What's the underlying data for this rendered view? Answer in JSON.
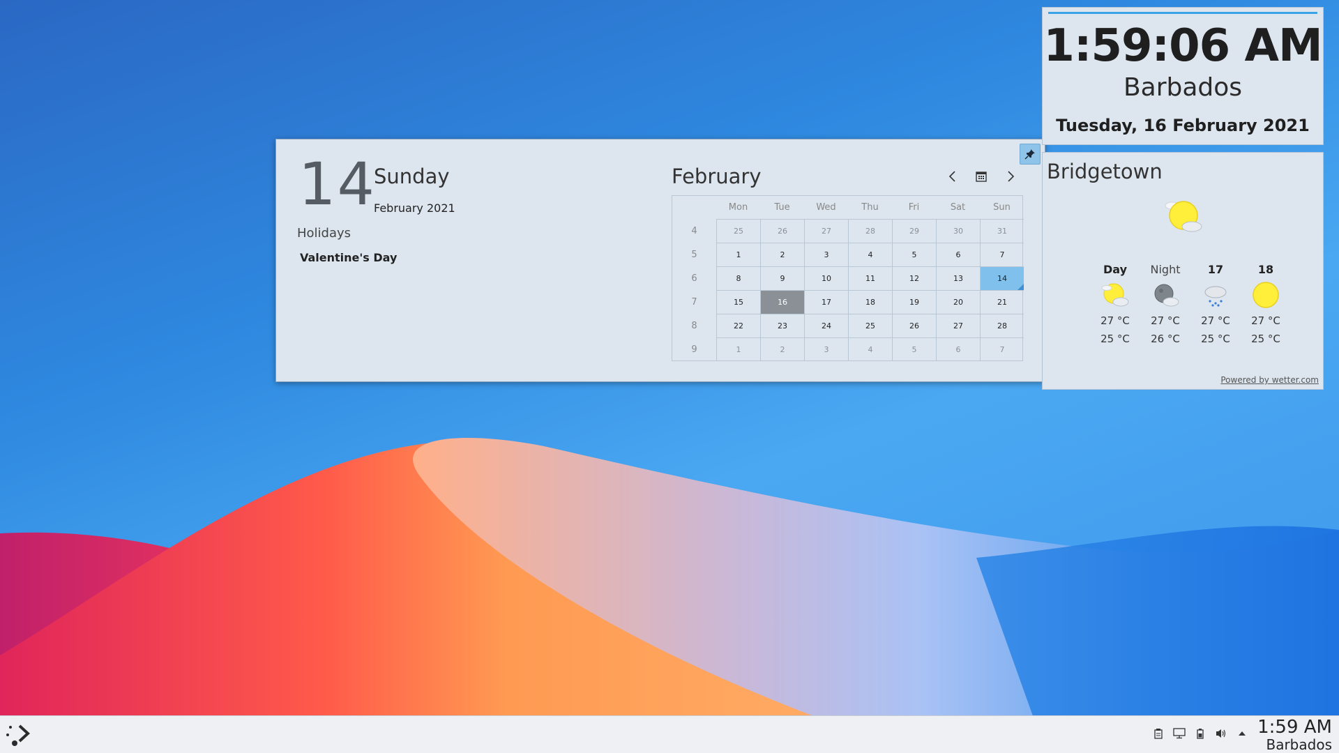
{
  "calendar": {
    "day_number": "14",
    "weekday": "Sunday",
    "month_year": "February 2021",
    "holidays_title": "Holidays",
    "holidays": [
      "Valentine's Day"
    ],
    "month_title": "February",
    "weekday_headers": [
      "Mon",
      "Tue",
      "Wed",
      "Thu",
      "Fri",
      "Sat",
      "Sun"
    ],
    "weeks": [
      {
        "num": "4",
        "days": [
          [
            "25",
            "other"
          ],
          [
            "26",
            "other"
          ],
          [
            "27",
            "other"
          ],
          [
            "28",
            "other"
          ],
          [
            "29",
            "other"
          ],
          [
            "30",
            "other"
          ],
          [
            "31",
            "other"
          ]
        ]
      },
      {
        "num": "5",
        "days": [
          [
            "1",
            ""
          ],
          [
            "2",
            ""
          ],
          [
            "3",
            ""
          ],
          [
            "4",
            ""
          ],
          [
            "5",
            ""
          ],
          [
            "6",
            ""
          ],
          [
            "7",
            ""
          ]
        ]
      },
      {
        "num": "6",
        "days": [
          [
            "8",
            ""
          ],
          [
            "9",
            ""
          ],
          [
            "10",
            ""
          ],
          [
            "11",
            ""
          ],
          [
            "12",
            ""
          ],
          [
            "13",
            ""
          ],
          [
            "14",
            "selected"
          ]
        ]
      },
      {
        "num": "7",
        "days": [
          [
            "15",
            ""
          ],
          [
            "16",
            "today"
          ],
          [
            "17",
            ""
          ],
          [
            "18",
            ""
          ],
          [
            "19",
            ""
          ],
          [
            "20",
            ""
          ],
          [
            "21",
            ""
          ]
        ]
      },
      {
        "num": "8",
        "days": [
          [
            "22",
            ""
          ],
          [
            "23",
            ""
          ],
          [
            "24",
            ""
          ],
          [
            "25",
            ""
          ],
          [
            "26",
            ""
          ],
          [
            "27",
            ""
          ],
          [
            "28",
            ""
          ]
        ]
      },
      {
        "num": "9",
        "days": [
          [
            "1",
            "other"
          ],
          [
            "2",
            "other"
          ],
          [
            "3",
            "other"
          ],
          [
            "4",
            "other"
          ],
          [
            "5",
            "other"
          ],
          [
            "6",
            "other"
          ],
          [
            "7",
            "other"
          ]
        ]
      }
    ]
  },
  "clock": {
    "time": "1:59:06 AM",
    "zone": "Barbados",
    "date": "Tuesday, 16 February 2021"
  },
  "weather": {
    "city": "Bridgetown",
    "main_icon": "sun-cloud-icon",
    "forecast": [
      {
        "label": "Day",
        "style": "bold",
        "icon": "sun-cloud-icon",
        "high": "27 °C",
        "low": "25 °C"
      },
      {
        "label": "Night",
        "style": "dim",
        "icon": "moon-cloud-icon",
        "high": "27 °C",
        "low": "26 °C"
      },
      {
        "label": "17",
        "style": "bold",
        "icon": "rain-cloud-icon",
        "high": "27 °C",
        "low": "25 °C"
      },
      {
        "label": "18",
        "style": "bold",
        "icon": "sun-icon",
        "high": "27 °C",
        "low": "25 °C"
      }
    ],
    "powered_by": "Powered by wetter.com"
  },
  "taskbar": {
    "time": "1:59 AM",
    "zone": "Barbados",
    "tray_icons": [
      "clipboard-icon",
      "display-icon",
      "battery-icon",
      "volume-icon",
      "expand-tray-icon"
    ]
  },
  "colors": {
    "accent": "#3da3e8",
    "selected_day": "#7fc0ec",
    "today_day": "#8a9096",
    "panel_bg": "#dde6ef"
  }
}
